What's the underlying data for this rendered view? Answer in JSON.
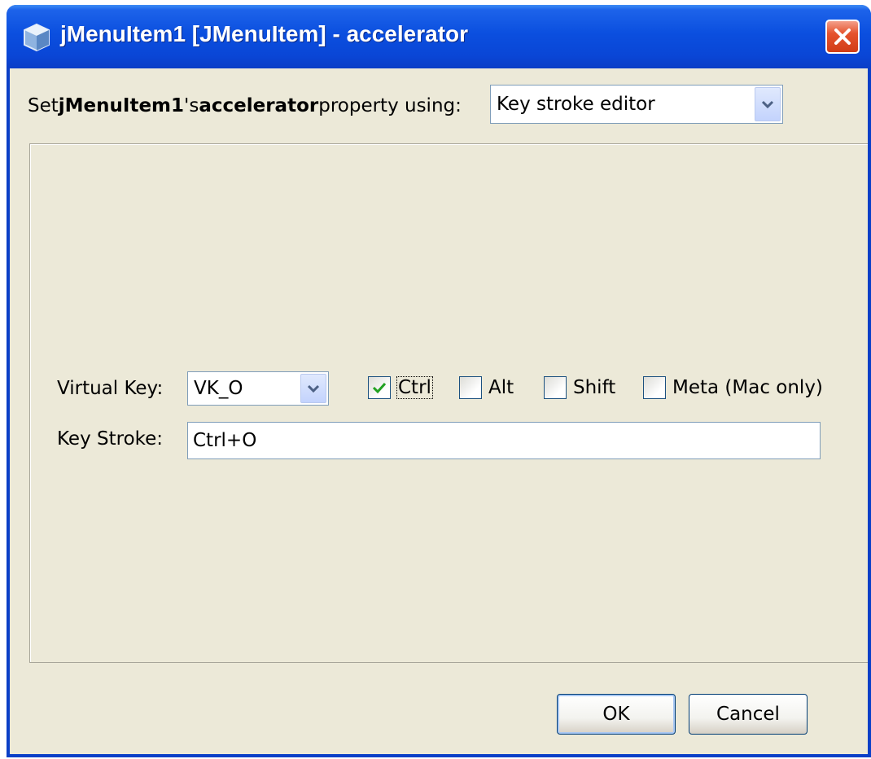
{
  "window": {
    "title": "jMenuItem1 [JMenuItem] - accelerator"
  },
  "property_row": {
    "prefix": "Set ",
    "component": "jMenuItem1",
    "possessive": "'s ",
    "property": "accelerator",
    "suffix": " property using:",
    "method_value": "Key stroke editor"
  },
  "editor": {
    "virtual_key_label": "Virtual Key:",
    "virtual_key_value": "VK_O",
    "modifiers": [
      {
        "label": "Ctrl",
        "checked": true
      },
      {
        "label": "Alt",
        "checked": false
      },
      {
        "label": "Shift",
        "checked": false
      },
      {
        "label": "Meta (Mac only)",
        "checked": false
      }
    ],
    "key_stroke_label": "Key Stroke:",
    "key_stroke_value": "Ctrl+O"
  },
  "buttons": {
    "ok": "OK",
    "cancel": "Cancel"
  },
  "icons": [
    "bean-icon",
    "close-icon",
    "chevron-down-icon",
    "checkmark-icon"
  ]
}
